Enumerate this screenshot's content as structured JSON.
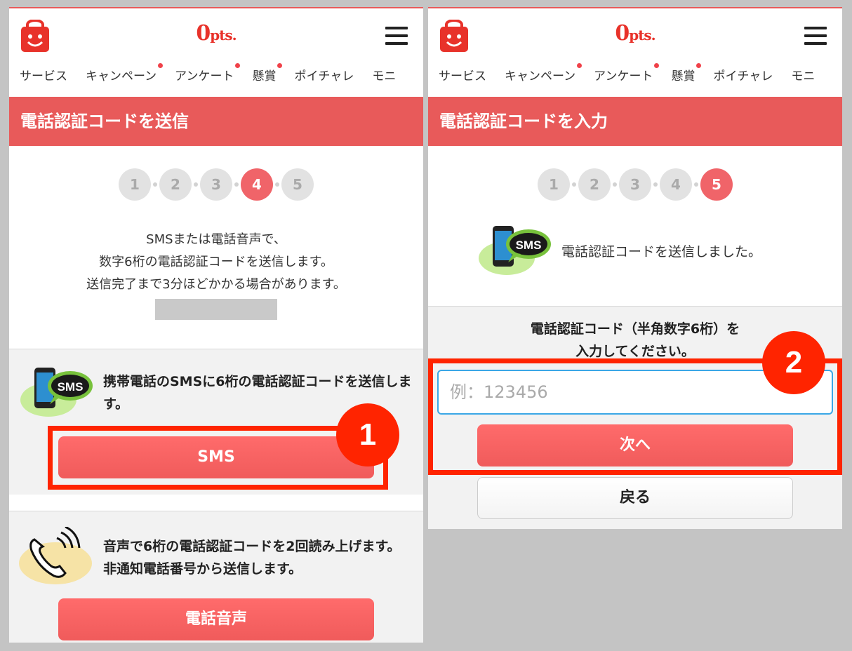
{
  "header": {
    "points_number": "0",
    "points_unit": "pts.",
    "nav": [
      "サービス",
      "キャンペーン",
      "アンケート",
      "懸賞",
      "ポイチャレ",
      "モニ"
    ]
  },
  "left": {
    "title": "電話認証コードを送信",
    "steps": [
      "1",
      "2",
      "3",
      "4",
      "5"
    ],
    "active_step": "4",
    "desc_lines": [
      "SMSまたは電話音声で、",
      "数字6桁の電話認証コードを送信します。",
      "送信完了まで3分ほどかかる場合があります。"
    ],
    "sms_icon_label": "SMS",
    "sms_option_text": "携帯電話のSMSに6桁の電話認証コードを送信します。",
    "sms_button": "SMS",
    "voice_option_text": "音声で6桁の電話認証コードを2回読み上げます。非通知電話番号から送信します。",
    "voice_button": "電話音声",
    "badge": "1"
  },
  "right": {
    "title": "電話認証コードを入力",
    "steps": [
      "1",
      "2",
      "3",
      "4",
      "5"
    ],
    "active_step": "5",
    "sms_icon_label": "SMS",
    "sent_message": "電話認証コードを送信しました。",
    "instruction_line1": "電話認証コード（半角数字6桁）を",
    "instruction_line2": "入力してください。",
    "input_placeholder": "例：123456",
    "next_button": "次へ",
    "back_button": "戻る",
    "badge": "2"
  },
  "colors": {
    "brand_red": "#e85a5a",
    "button_red": "#ff6b6b",
    "highlight": "#ff2400",
    "input_focus": "#3aa7e6"
  }
}
